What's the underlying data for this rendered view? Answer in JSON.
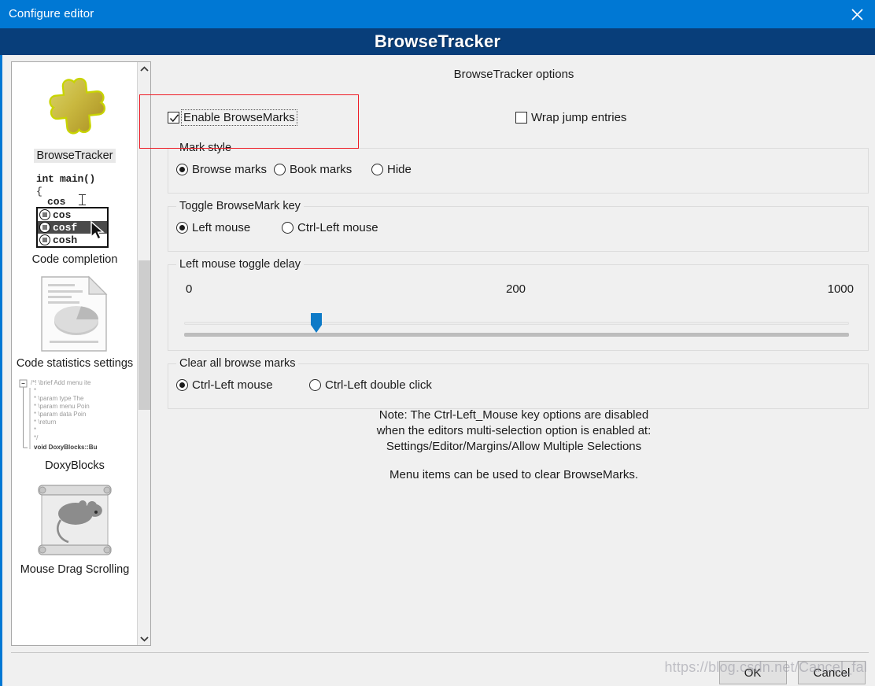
{
  "window": {
    "title": "Configure editor",
    "close_icon": "close-icon",
    "header_title": "BrowseTracker"
  },
  "sidebar": {
    "items": [
      {
        "label": "BrowseTracker",
        "icon": "puzzle-piece-icon",
        "selected": true
      },
      {
        "label": "Code completion",
        "icon": "code-completion-icon",
        "selected": false
      },
      {
        "label": "Code statistics settings",
        "icon": "document-pie-chart-icon",
        "selected": false
      },
      {
        "label": "DoxyBlocks",
        "icon": "doxygen-comment-icon",
        "selected": false
      },
      {
        "label": "Mouse Drag Scrolling",
        "icon": "mouse-scroll-icon",
        "selected": false
      }
    ],
    "scroll_up_icon": "chevron-up-icon",
    "scroll_down_icon": "chevron-down-icon"
  },
  "pane": {
    "title": "BrowseTracker options",
    "checkboxes": [
      {
        "label": "Enable BrowseMarks",
        "checked": true,
        "focused": true
      },
      {
        "label": "Wrap jump entries",
        "checked": false,
        "focused": false
      }
    ],
    "groups": [
      {
        "title": "Mark style",
        "options": [
          {
            "label": "Browse marks",
            "checked": true
          },
          {
            "label": "Book marks",
            "checked": false
          },
          {
            "label": "Hide",
            "checked": false
          }
        ]
      },
      {
        "title": "Toggle BrowseMark key",
        "options": [
          {
            "label": "Left mouse",
            "checked": true
          },
          {
            "label": "Ctrl-Left mouse",
            "checked": false
          }
        ]
      },
      {
        "title": "Left mouse toggle delay",
        "scale": [
          "0",
          "200",
          "1000"
        ],
        "slider": {
          "min": 0,
          "max": 1000,
          "value": 190
        }
      },
      {
        "title": "Clear all browse marks",
        "options": [
          {
            "label": "Ctrl-Left mouse",
            "checked": true
          },
          {
            "label": "Ctrl-Left double click",
            "checked": false
          }
        ]
      }
    ],
    "note": {
      "line1": "Note: The Ctrl-Left_Mouse key options are disabled",
      "line2": "when the editors multi-selection option is enabled at:",
      "line3": "Settings/Editor/Margins/Allow Multiple Selections",
      "line4": "Menu items can be used to clear BrowseMarks."
    }
  },
  "footer": {
    "ok_label": "OK",
    "cancel_label": "Cancel"
  },
  "watermark": "https://blog.csdn.net/Cancel_fal",
  "sidebar_thumbs": {
    "code_completion": {
      "line1": "int main()",
      "line2": "{",
      "line3": "cos",
      "items": [
        "cos",
        "cosf",
        "cosh"
      ],
      "selected_index": 1
    },
    "doxyblocks": {
      "lines": [
        "/*! \\brief Add menu ite",
        "*",
        "* \\param type    The ",
        "* \\param menu  Poin",
        "* \\param data   Poin",
        "* \\return",
        "*",
        "*/",
        "void DoxyBlocks::Bu"
      ]
    }
  },
  "colors": {
    "titlebar": "#0078d4",
    "header_band": "#083e7a",
    "dialog_bg": "#f0f0f0",
    "annotation": "#ee1c25",
    "slider_thumb": "#0d7ac7"
  }
}
